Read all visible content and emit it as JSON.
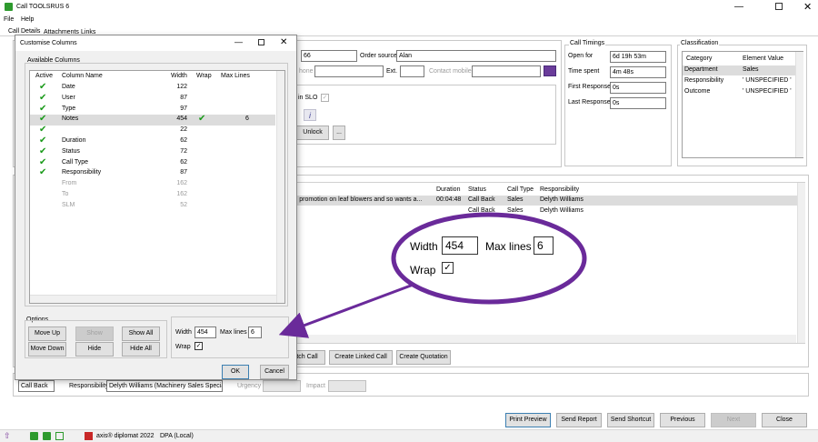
{
  "window": {
    "title": "Call TOOLSRUS 6"
  },
  "menu": [
    "File",
    "Help"
  ],
  "tabs": [
    "Call Details",
    "Attachments",
    "Links"
  ],
  "call": {
    "field_66": "66",
    "order_source_label": "Order source",
    "order_source": "Alan",
    "phone_label": "hone",
    "ext_label": "Ext.",
    "contact_mobile_label": "Contact mobile",
    "in_slo_label": "in SLO",
    "unlock_label": "Unlock",
    "ellipsis_label": "..."
  },
  "timings": {
    "title": "Call Timings",
    "rows": [
      {
        "label": "Open for",
        "value": "6d 19h 53m"
      },
      {
        "label": "Time spent",
        "value": "4m 48s"
      },
      {
        "label": "First Response",
        "value": "0s"
      },
      {
        "label": "Last Response",
        "value": "0s"
      }
    ]
  },
  "classification": {
    "title": "Classification",
    "headers": [
      "Category",
      "Element Value"
    ],
    "rows": [
      {
        "category": "Department",
        "value": "Sales"
      },
      {
        "category": "Responsibility",
        "value": "' UNSPECIFIED '"
      },
      {
        "category": "Outcome",
        "value": "' UNSPECIFIED '"
      }
    ]
  },
  "history": {
    "headers": [
      "Duration",
      "Status",
      "Call Type",
      "Responsibility"
    ],
    "rows": [
      {
        "notes": "nal promotion on leaf blowers and so wants a...",
        "duration": "00:04:48",
        "status": "Call Back",
        "type": "Sales",
        "resp": "Delyth Williams"
      },
      {
        "notes": "",
        "duration": "",
        "status": "Call Back",
        "type": "Sales",
        "resp": "Delyth Williams"
      }
    ]
  },
  "actions": {
    "match_call": "tch Call",
    "create_linked": "Create Linked Call",
    "create_quotation": "Create Quotation"
  },
  "status_bar": {
    "status": "Call Back",
    "responsibility_label": "Responsibility",
    "responsibility": "Delyth Williams (Machinery Sales Specialist)",
    "urgency_label": "Urgency",
    "impact_label": "Impact"
  },
  "footer_buttons": [
    "Print Preview",
    "Send Report",
    "Send Shortcut",
    "Previous",
    "Next",
    "Close"
  ],
  "taskbar": {
    "app": "axis® diplomat 2022",
    "db": "DPA (Local)"
  },
  "dialog": {
    "title": "Customise Columns",
    "available_label": "Available Columns",
    "headers": [
      "Active",
      "Column Name",
      "Width",
      "Wrap",
      "Max Lines"
    ],
    "columns": [
      {
        "active": true,
        "name": "Date",
        "width": "122",
        "wrap": false,
        "max": "",
        "enabled": true,
        "selected": false
      },
      {
        "active": true,
        "name": "User",
        "width": "87",
        "wrap": false,
        "max": "",
        "enabled": true,
        "selected": false
      },
      {
        "active": true,
        "name": "Type",
        "width": "97",
        "wrap": false,
        "max": "",
        "enabled": true,
        "selected": false
      },
      {
        "active": true,
        "name": "Notes",
        "width": "454",
        "wrap": true,
        "max": "6",
        "enabled": true,
        "selected": true
      },
      {
        "active": true,
        "name": "",
        "width": "22",
        "wrap": false,
        "max": "",
        "enabled": true,
        "selected": false
      },
      {
        "active": true,
        "name": "Duration",
        "width": "62",
        "wrap": false,
        "max": "",
        "enabled": true,
        "selected": false
      },
      {
        "active": true,
        "name": "Status",
        "width": "72",
        "wrap": false,
        "max": "",
        "enabled": true,
        "selected": false
      },
      {
        "active": true,
        "name": "Call Type",
        "width": "62",
        "wrap": false,
        "max": "",
        "enabled": true,
        "selected": false
      },
      {
        "active": true,
        "name": "Responsibility",
        "width": "87",
        "wrap": false,
        "max": "",
        "enabled": true,
        "selected": false
      },
      {
        "active": false,
        "name": "From",
        "width": "162",
        "wrap": false,
        "max": "",
        "enabled": false,
        "selected": false
      },
      {
        "active": false,
        "name": "To",
        "width": "162",
        "wrap": false,
        "max": "",
        "enabled": false,
        "selected": false
      },
      {
        "active": false,
        "name": "SLM",
        "width": "52",
        "wrap": false,
        "max": "",
        "enabled": false,
        "selected": false
      }
    ],
    "options_label": "Options",
    "move_up": "Move Up",
    "show": "Show",
    "show_all": "Show All",
    "move_down": "Move Down",
    "hide": "Hide",
    "hide_all": "Hide All",
    "width_label": "Width",
    "width_value": "454",
    "max_lines_label": "Max lines",
    "max_lines_value": "6",
    "wrap_label": "Wrap",
    "ok": "OK",
    "cancel": "Cancel"
  },
  "callout": {
    "width_label": "Width",
    "width_value": "454",
    "max_lines_label": "Max lines",
    "max_lines_value": "6",
    "wrap_label": "Wrap"
  },
  "colors": {
    "accent_purple": "#6a2a9a",
    "check_green": "#1a9a1a"
  }
}
